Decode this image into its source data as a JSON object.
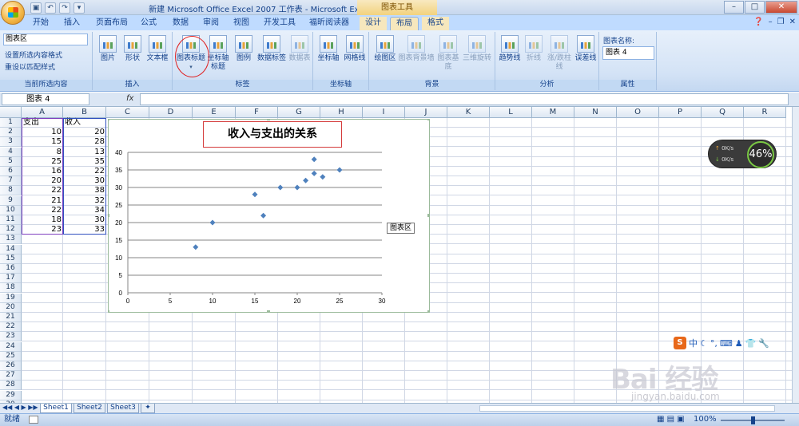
{
  "window": {
    "title": "新建 Microsoft Office Excel 2007 工作表 - Microsoft Excel",
    "context_title": "图表工具",
    "controls": [
      "–",
      "□",
      "✕"
    ]
  },
  "tabs": [
    "开始",
    "插入",
    "页面布局",
    "公式",
    "数据",
    "审阅",
    "视图",
    "开发工具",
    "福昕阅读器",
    "设计",
    "布局",
    "格式"
  ],
  "active_tab": "布局",
  "ribbon": {
    "current_selection": {
      "dropdown_value": "图表区",
      "format_selection": "设置所选内容格式",
      "reset_style": "重设以匹配样式",
      "label": "当前所选内容"
    },
    "insert": {
      "items": [
        "图片",
        "形状",
        "文本框"
      ],
      "label": "插入"
    },
    "labels": {
      "items": [
        "图表标题",
        "坐标轴标题",
        "图例",
        "数据标签",
        "数据表"
      ],
      "label": "标签"
    },
    "axes": {
      "items": [
        "坐标轴",
        "网格线"
      ],
      "label": "坐标轴"
    },
    "background": {
      "items": [
        "绘图区",
        "图表背景墙",
        "图表基底",
        "三维旋转"
      ],
      "label": "背景"
    },
    "analysis": {
      "items": [
        "趋势线",
        "折线",
        "涨/跌柱线",
        "误差线"
      ],
      "label": "分析"
    },
    "properties": {
      "chart_name_label": "图表名称:",
      "chart_name_value": "图表 4",
      "label": "属性"
    }
  },
  "formula_bar": {
    "name_box": "图表 4",
    "fx": "fx",
    "value": ""
  },
  "columns": [
    "A",
    "B",
    "C",
    "D",
    "E",
    "F",
    "G",
    "H",
    "I",
    "J",
    "K",
    "L",
    "M",
    "N",
    "O",
    "P",
    "Q",
    "R"
  ],
  "rows": [
    "1",
    "2",
    "3",
    "4",
    "5",
    "6",
    "7",
    "8",
    "9",
    "10",
    "11",
    "12",
    "13",
    "14",
    "15",
    "16",
    "17",
    "18",
    "19",
    "20",
    "21",
    "22",
    "23",
    "24",
    "25",
    "26",
    "27",
    "28",
    "29",
    "30"
  ],
  "table": {
    "headers": [
      "支出",
      "收入"
    ],
    "rows": [
      [
        "10",
        "20"
      ],
      [
        "15",
        "28"
      ],
      [
        "8",
        "13"
      ],
      [
        "25",
        "35"
      ],
      [
        "16",
        "22"
      ],
      [
        "20",
        "30"
      ],
      [
        "22",
        "38"
      ],
      [
        "21",
        "32"
      ],
      [
        "22",
        "34"
      ],
      [
        "18",
        "30"
      ],
      [
        "23",
        "33"
      ]
    ]
  },
  "chart_data": {
    "type": "scatter",
    "title": "收入与支出的关系",
    "x": [
      10,
      15,
      8,
      25,
      16,
      20,
      22,
      21,
      22,
      18,
      23
    ],
    "y": [
      20,
      28,
      13,
      35,
      22,
      30,
      38,
      32,
      34,
      30,
      33
    ],
    "xlim": [
      0,
      30
    ],
    "ylim": [
      0,
      40
    ],
    "xticks": [
      "0",
      "5",
      "10",
      "15",
      "20",
      "25",
      "30"
    ],
    "yticks": [
      "0",
      "5",
      "10",
      "15",
      "20",
      "25",
      "30",
      "35",
      "40"
    ],
    "grid": "horizontal",
    "marker": "diamond",
    "color": "#4f81bd"
  },
  "tooltip": "图表区",
  "sheets": [
    "Sheet1",
    "Sheet2",
    "Sheet3"
  ],
  "active_sheet": "Sheet1",
  "status": {
    "mode": "就绪",
    "zoom": "100%"
  },
  "widget": {
    "up": "0K/s",
    "down": "0K/s",
    "percent": "46%"
  },
  "ime": {
    "lang": "中"
  },
  "watermark": {
    "brand": "Bai 经验",
    "url": "jingyan.baidu.com"
  }
}
